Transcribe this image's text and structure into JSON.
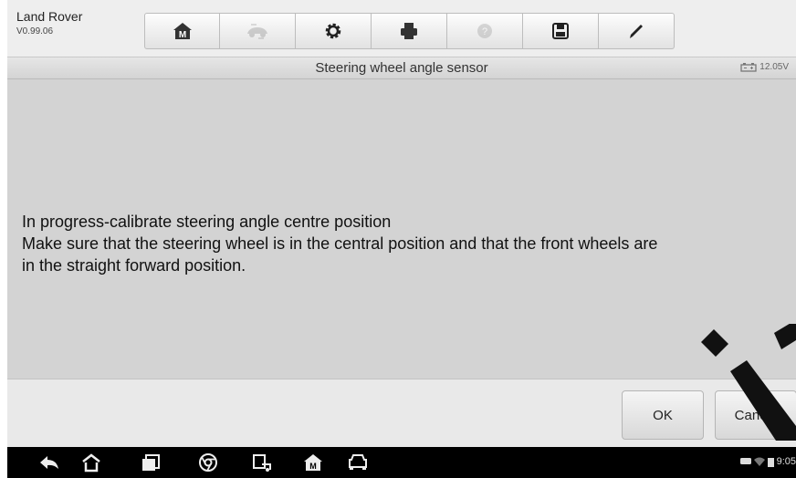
{
  "app": {
    "name": "Land Rover",
    "version": "V0.99.06"
  },
  "toolbar": {
    "buttons": [
      {
        "icon": "home-icon",
        "enabled": true
      },
      {
        "icon": "vehicle-swap-icon",
        "enabled": false
      },
      {
        "icon": "settings-gear-icon",
        "enabled": true
      },
      {
        "icon": "printer-icon",
        "enabled": true
      },
      {
        "icon": "help-icon",
        "enabled": false
      },
      {
        "icon": "save-icon",
        "enabled": true
      },
      {
        "icon": "pen-icon",
        "enabled": true
      }
    ]
  },
  "header": {
    "title": "Steering wheel angle sensor",
    "battery_voltage": "12.05V"
  },
  "message": {
    "line1": "In progress-calibrate steering angle centre position",
    "line2": "Make sure that the steering wheel is in the central position and that the front wheels are",
    "line3": "in the straight forward position."
  },
  "buttons": {
    "ok": "OK",
    "cancel": "Cancel"
  },
  "navbar": {
    "icons": [
      "back-icon",
      "android-home-icon",
      "recent-apps-icon",
      "chrome-icon",
      "remote-support-icon",
      "maxisys-icon",
      "car-icon"
    ]
  },
  "status": {
    "time": "9:05"
  },
  "colors": {
    "content_bg": "#d3d3d3",
    "nav_bg": "#000000"
  }
}
